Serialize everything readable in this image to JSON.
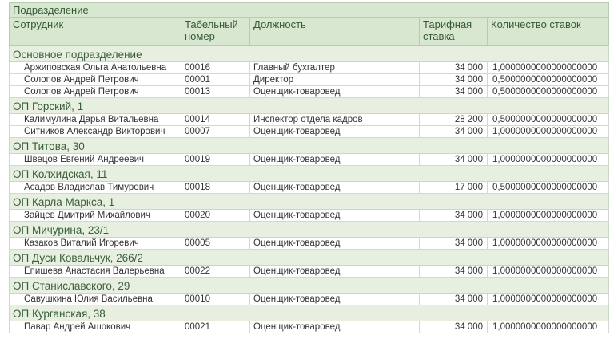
{
  "header": {
    "group_label": "Подразделение",
    "columns": [
      "Сотрудник",
      "Табельный номер",
      "Должность",
      "Тарифная ставка",
      "Количество ставок"
    ]
  },
  "groups": [
    {
      "name": "Основное подразделение",
      "rows": [
        {
          "employee": "Аржиповская Ольга Анатольевна",
          "tab_no": "00016",
          "position": "Главный бухгалтер",
          "rate": "34 000",
          "count": "1,0000000000000000000"
        },
        {
          "employee": "Солопов Андрей Петрович",
          "tab_no": "00001",
          "position": "Директор",
          "rate": "34 000",
          "count": "0,5000000000000000000"
        },
        {
          "employee": "Солопов Андрей Петрович",
          "tab_no": "00013",
          "position": "Оценщик-товаровед",
          "rate": "34 000",
          "count": "0,5000000000000000000"
        }
      ]
    },
    {
      "name": "ОП Горский, 1",
      "rows": [
        {
          "employee": "Калимулина Дарья Витальевна",
          "tab_no": "00014",
          "position": "Инспектор отдела кадров",
          "rate": "28 200",
          "count": "0,5000000000000000000"
        },
        {
          "employee": "Ситников Александр Викторович",
          "tab_no": "00007",
          "position": "Оценщик-товаровед",
          "rate": "34 000",
          "count": "1,0000000000000000000"
        }
      ]
    },
    {
      "name": "ОП Титова, 30",
      "rows": [
        {
          "employee": "Швецов Евгений Андреевич",
          "tab_no": "00019",
          "position": "Оценщик-товаровед",
          "rate": "34 000",
          "count": "1,0000000000000000000"
        }
      ]
    },
    {
      "name": "ОП Колхидская, 11",
      "rows": [
        {
          "employee": "Асадов Владислав Тимурович",
          "tab_no": "00018",
          "position": "Оценщик-товаровед",
          "rate": "17 000",
          "count": "0,5000000000000000000"
        }
      ]
    },
    {
      "name": "ОП Карла Маркса, 1",
      "rows": [
        {
          "employee": "Зайцев Дмитрий Михайлович",
          "tab_no": "00020",
          "position": "Оценщик-товаровед",
          "rate": "34 000",
          "count": "1,0000000000000000000"
        }
      ]
    },
    {
      "name": "ОП Мичурина, 23/1",
      "rows": [
        {
          "employee": "Казаков Виталий Игоревич",
          "tab_no": "00005",
          "position": "Оценщик-товаровед",
          "rate": "34 000",
          "count": "1,0000000000000000000"
        }
      ]
    },
    {
      "name": "ОП Дуси Ковальчук, 266/2",
      "rows": [
        {
          "employee": "Епишева Анастасия Валерьевна",
          "tab_no": "00022",
          "position": "Оценщик-товаровед",
          "rate": "34 000",
          "count": "1,0000000000000000000"
        }
      ]
    },
    {
      "name": "ОП Станиславского, 29",
      "rows": [
        {
          "employee": "Савушкина Юлия Васильевна",
          "tab_no": "00010",
          "position": "Оценщик-товаровед",
          "rate": "34 000",
          "count": "1,0000000000000000000"
        }
      ]
    },
    {
      "name": "ОП Курганская, 38",
      "rows": [
        {
          "employee": "Павар Андрей Ашокович",
          "tab_no": "00021",
          "position": "Оценщик-товаровед",
          "rate": "34 000",
          "count": "1,0000000000000000000"
        }
      ]
    }
  ]
}
